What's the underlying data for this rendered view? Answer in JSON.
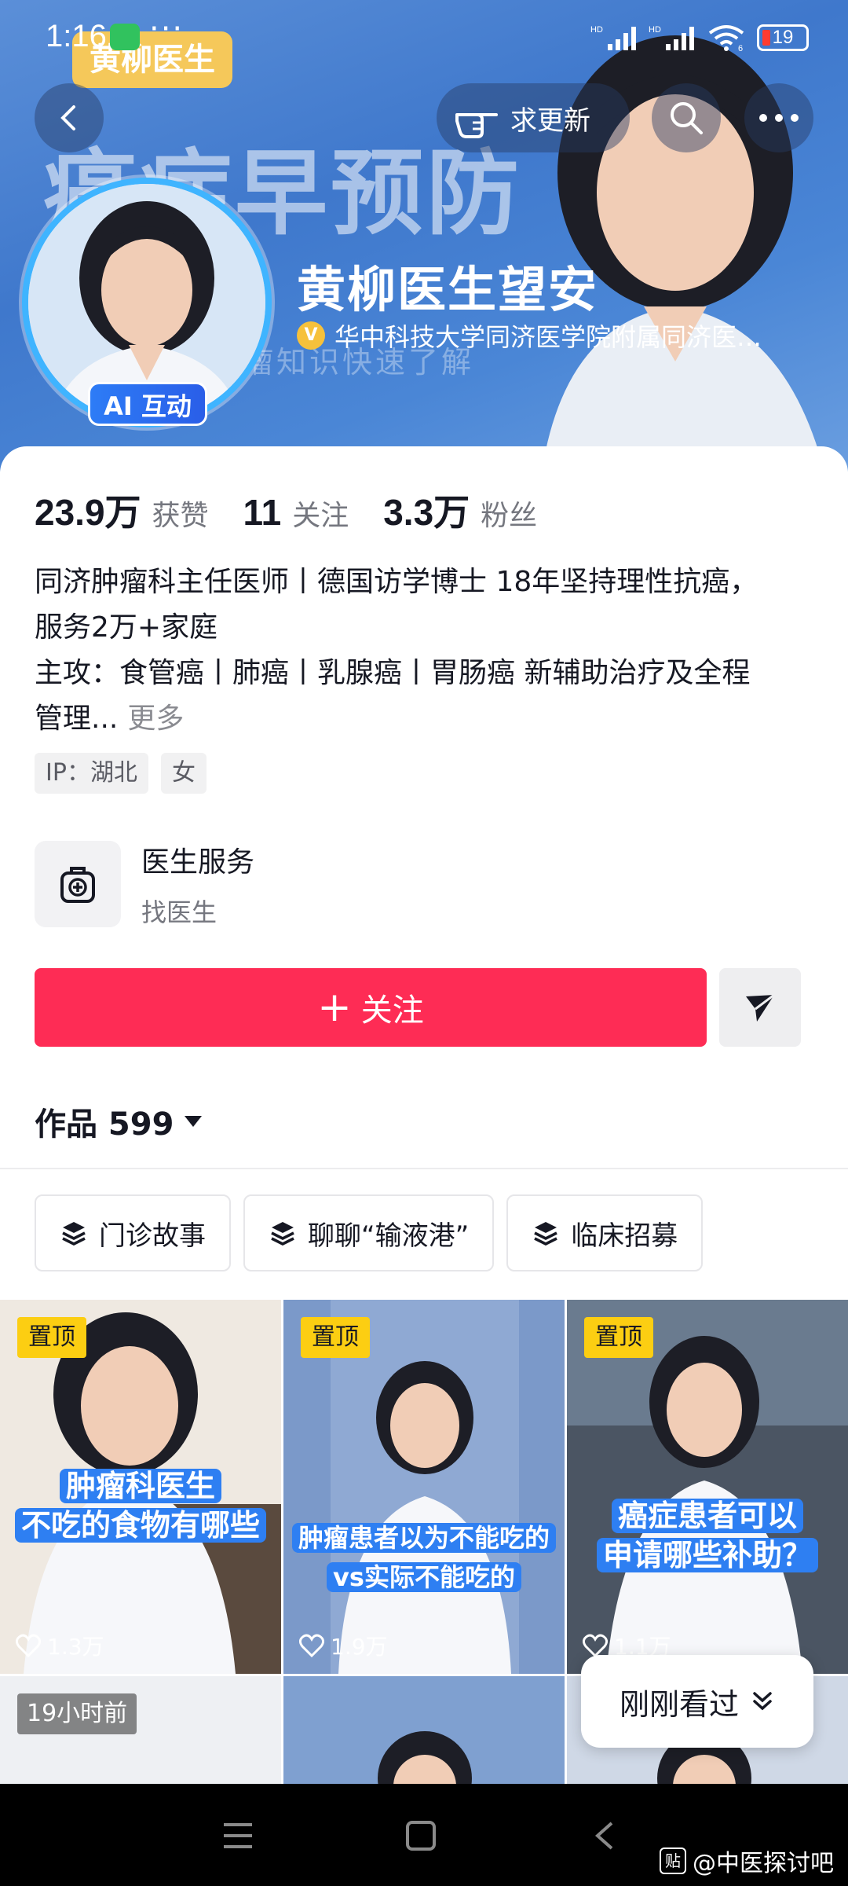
{
  "status_bar": {
    "time": "1:16",
    "dots": "···",
    "signal1": "HD",
    "signal2": "HD",
    "wifi_sub": "6",
    "battery": "19"
  },
  "banner": {
    "brand_badge": "黄柳医生",
    "big_text": "癌症早预防",
    "sub_text": "瘤知识快速了解"
  },
  "header": {
    "update_label": "求更新"
  },
  "profile": {
    "name": "黄柳医生望安",
    "ai_badge": "AI 互动",
    "verify_mark": "V",
    "verification": "华中科技大学同济医学院附属同济医…"
  },
  "stats": [
    {
      "value": "23.9万",
      "label": "获赞"
    },
    {
      "value": "11",
      "label": "关注"
    },
    {
      "value": "3.3万",
      "label": "粉丝"
    }
  ],
  "bio": {
    "line1": "同济肿瘤科主任医师丨德国访学博士 18年坚持理性抗癌，",
    "line2": "服务2万+家庭",
    "line3": "主攻：食管癌丨肺癌丨乳腺癌丨胃肠癌 新辅助治疗及全程",
    "line4": "管理...",
    "more": "更多"
  },
  "tags": [
    "IP：湖北",
    "女"
  ],
  "service": {
    "title": "医生服务",
    "subtitle": "找医生"
  },
  "follow": {
    "plus": "+",
    "label": "关注"
  },
  "works": {
    "label": "作品 599"
  },
  "collections": [
    "门诊故事",
    "聊聊“输液港”",
    "临床招募"
  ],
  "videos": [
    {
      "badge": "置顶",
      "caption1": "肿瘤科医生",
      "caption2": "不吃的食物有哪些",
      "likes": "1.3万"
    },
    {
      "badge": "置顶",
      "caption1": "肿瘤患者以为不能吃的",
      "caption2": "vs实际不能吃的",
      "likes": "1.9万"
    },
    {
      "badge": "置顶",
      "caption1": "癌症患者可以",
      "caption2": "申请哪些补助？",
      "likes": "1.1万"
    },
    {
      "badge": "19小时前"
    }
  ],
  "recent": {
    "label": "刚刚看过"
  },
  "watermark": {
    "logo": "贴",
    "text": "@中医探讨吧"
  },
  "colors": {
    "accent": "#fe2c55",
    "pin_badge": "#fcce12",
    "banner_blue": "#4a86d6",
    "ai_badge": "#2d7cf6"
  }
}
